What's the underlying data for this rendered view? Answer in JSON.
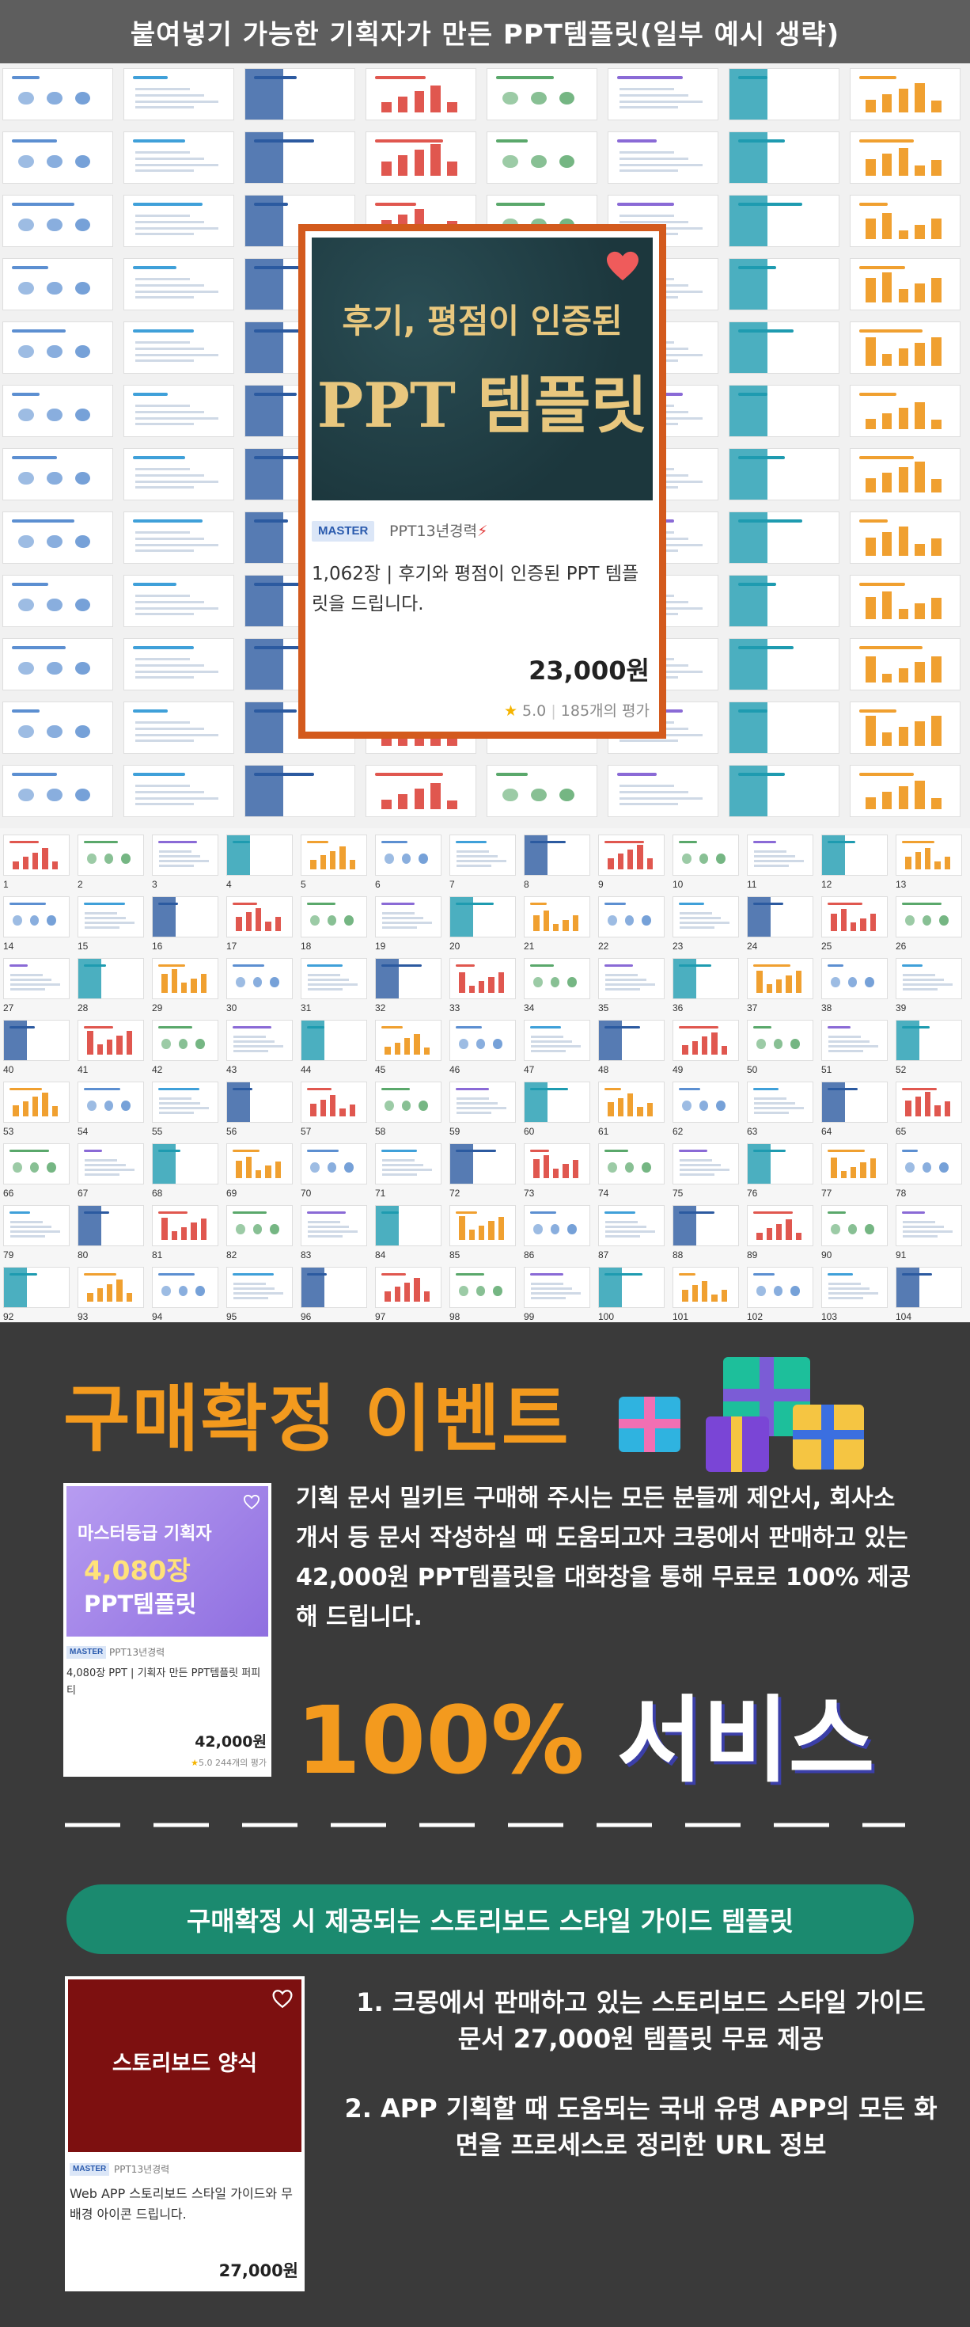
{
  "banner": {
    "title": "붙여넣기 가능한 기획자가 만든 PPT템플릿(일부 예시 생략)"
  },
  "featured_card": {
    "headline": "후기, 평점이 인증된",
    "big_text": "PPT 템플릿",
    "badge": "MASTER",
    "seller": "PPT13년경력",
    "lightning": "⚡",
    "description": "1,062장 | 후기와 평점이 인증된 PPT 템플릿을 드립니다.",
    "price": "23,000원",
    "rating": "5.0",
    "review_count": "185개의 평가",
    "heart_icon": "heart-icon"
  },
  "grid2_numbers": [
    "1",
    "2",
    "3",
    "4",
    "5",
    "6",
    "7",
    "8",
    "9",
    "10",
    "11",
    "12",
    "13",
    "14",
    "15",
    "16",
    "17",
    "18",
    "19",
    "20",
    "21",
    "22",
    "23",
    "24",
    "25",
    "26",
    "27",
    "28",
    "29",
    "30",
    "31",
    "32",
    "33",
    "34",
    "35",
    "36",
    "37",
    "38",
    "39",
    "40",
    "41",
    "42",
    "43",
    "44",
    "45",
    "46",
    "47",
    "48",
    "49",
    "50",
    "51",
    "52",
    "53",
    "54",
    "55",
    "56",
    "57",
    "58",
    "59",
    "60",
    "61",
    "62",
    "63",
    "64",
    "65",
    "66",
    "67",
    "68",
    "69",
    "70",
    "71",
    "72",
    "73",
    "74",
    "75",
    "76",
    "77",
    "78",
    "79",
    "80",
    "81",
    "82",
    "83",
    "84",
    "85",
    "86",
    "87",
    "88",
    "89",
    "90",
    "91",
    "92",
    "93",
    "94",
    "95",
    "96",
    "97",
    "98",
    "99",
    "100",
    "101",
    "102",
    "103",
    "104"
  ],
  "event": {
    "title": "구매확정 이벤트",
    "product1": {
      "line1": "마스터등급 기획자",
      "line2": "4,080장",
      "line3": "PPT템플릿",
      "badge": "MASTER",
      "seller": "PPT13년경력",
      "description": "4,080장 PPT | 기획자 만든 PPT템플릿 퍼피티",
      "price": "42,000원",
      "rating": "5.0",
      "reviews": "244개의 평가"
    },
    "description": "기획 문서 밀키트 구매해 주시는 모든 분들께 제안서, 회사소개서 등 문서 작성하실 때 도움되고자 크몽에서 판매하고 있는 42,000원 PPT템플릿을 대화창을 통해 무료로 100% 제공해 드립니다.",
    "service_orange": "100%",
    "service_white": "서비스",
    "pill": "구매확정 시 제공되는 스토리보드 스타일 가이드 템플릿",
    "product2": {
      "title": "스토리보드 양식",
      "badge": "MASTER",
      "seller": "PPT13년경력",
      "description": "Web APP 스토리보드 스타일 가이드와 무배경 아이콘 드립니다.",
      "price": "27,000원"
    },
    "list": [
      "1. 크몽에서 판매하고 있는 스토리보드 스타일 가이드 문서 27,000원 템플릿 무료 제공",
      "2. APP 기획할 때 도움되는 국내 유명 APP의 모든 화면을 프로세스로 정리한 URL 정보"
    ]
  },
  "colors": {
    "card_border": "#d35a1d",
    "accent_orange": "#f39a1e",
    "pill_green": "#1b8a6f",
    "dark_bg": "#3a3a3a"
  }
}
